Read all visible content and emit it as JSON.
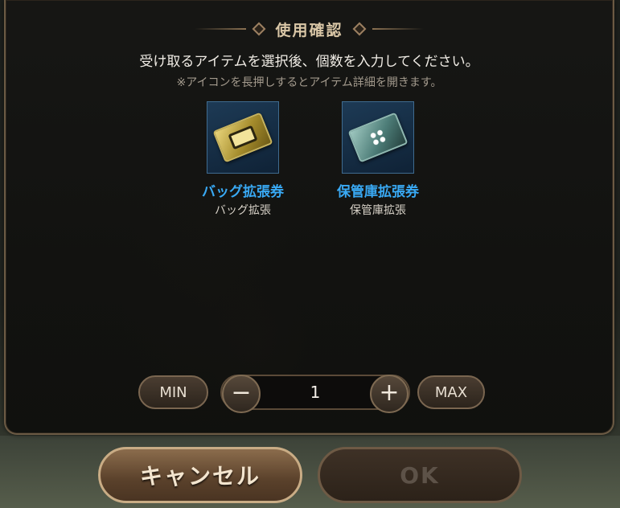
{
  "dialog": {
    "title": "使用確認",
    "instruction": "受け取るアイテムを選択後、個数を入力してください。",
    "note": "※アイコンを長押しするとアイテム詳細を開きます。"
  },
  "items": [
    {
      "name": "バッグ拡張券",
      "subtitle": "バッグ拡張",
      "icon": "bag-expansion-ticket-icon",
      "color": "#39a9f4"
    },
    {
      "name": "保管庫拡張券",
      "subtitle": "保管庫拡張",
      "icon": "storage-expansion-ticket-icon",
      "color": "#39a9f4"
    }
  ],
  "quantity": {
    "min_label": "MIN",
    "max_label": "MAX",
    "minus_label": "−",
    "plus_label": "+",
    "value": "1"
  },
  "buttons": {
    "cancel_label": "キャンセル",
    "ok_label": "OK"
  },
  "colors": {
    "item_name": "#39a9f4",
    "title": "#d9c6a6",
    "ok_disabled_text": "#5d5248"
  }
}
